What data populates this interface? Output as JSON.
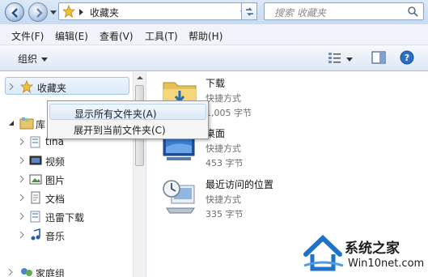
{
  "address_bar": {
    "breadcrumb": "收藏夹",
    "search_placeholder": "搜索 收藏夹"
  },
  "menu": [
    "文件(F)",
    "编辑(E)",
    "查看(V)",
    "工具(T)",
    "帮助(H)"
  ],
  "toolbar": {
    "organize_label": "组织"
  },
  "nav": {
    "favorites": "收藏夹",
    "library": "库",
    "items": [
      "tina",
      "视频",
      "图片",
      "文档",
      "迅雷下载",
      "音乐"
    ],
    "homegroup": "家庭组"
  },
  "context_menu": {
    "items": [
      "显示所有文件夹(A)",
      "展开到当前文件夹(C)"
    ]
  },
  "files": [
    {
      "name": "下载",
      "type": "快捷方式",
      "size": "1,005 字节",
      "icon": "downloads-folder-icon"
    },
    {
      "name": "桌面",
      "type": "快捷方式",
      "size": "453 字节",
      "icon": "desktop-icon"
    },
    {
      "name": "最近访问的位置",
      "type": "快捷方式",
      "size": "335 字节",
      "icon": "recent-places-icon"
    }
  ],
  "watermark": {
    "title": "系统之家",
    "url": "Win10net.com"
  },
  "colors": {
    "chrome_top": "#dbe8f7",
    "selection": "#dbe9f9",
    "accent": "#1e73c8"
  }
}
